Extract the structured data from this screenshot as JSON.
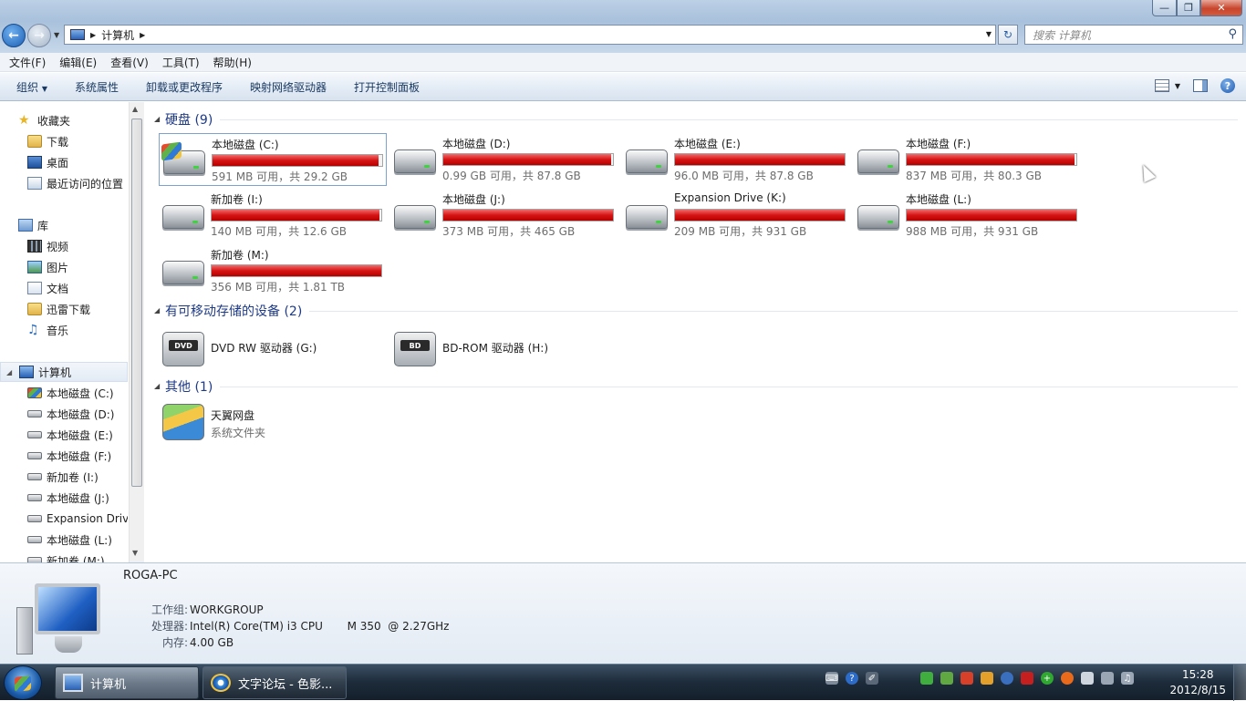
{
  "window": {
    "address": {
      "location": "计算机"
    },
    "search": {
      "placeholder": "搜索 计算机"
    }
  },
  "menu": [
    "文件(F)",
    "编辑(E)",
    "查看(V)",
    "工具(T)",
    "帮助(H)"
  ],
  "toolbar": {
    "organize": "组织",
    "items": [
      "系统属性",
      "卸载或更改程序",
      "映射网络驱动器",
      "打开控制面板"
    ]
  },
  "nav": {
    "favorites": {
      "label": "收藏夹",
      "items": [
        "下载",
        "桌面",
        "最近访问的位置"
      ]
    },
    "libraries": {
      "label": "库",
      "items": [
        "视频",
        "图片",
        "文档",
        "迅雷下载",
        "音乐"
      ]
    },
    "computer": {
      "label": "计算机",
      "items": [
        "本地磁盘 (C:)",
        "本地磁盘 (D:)",
        "本地磁盘 (E:)",
        "本地磁盘 (F:)",
        "新加卷 (I:)",
        "本地磁盘 (J:)",
        "Expansion Drive (K:)",
        "本地磁盘 (L:)",
        "新加卷 (M:)"
      ]
    }
  },
  "groups": {
    "hdd": {
      "title": "硬盘 (9)",
      "drives": [
        {
          "name": "本地磁盘 (C:)",
          "free": "591 MB 可用，共 29.2 GB",
          "used_fraction": 0.98
        },
        {
          "name": "本地磁盘 (D:)",
          "free": "0.99 GB 可用，共 87.8 GB",
          "used_fraction": 0.99
        },
        {
          "name": "本地磁盘 (E:)",
          "free": "96.0 MB 可用，共 87.8 GB",
          "used_fraction": 0.999
        },
        {
          "name": "本地磁盘 (F:)",
          "free": "837 MB 可用，共 80.3 GB",
          "used_fraction": 0.99
        },
        {
          "name": "新加卷 (I:)",
          "free": "140 MB 可用，共 12.6 GB",
          "used_fraction": 0.99
        },
        {
          "name": "本地磁盘 (J:)",
          "free": "373 MB 可用，共 465 GB",
          "used_fraction": 0.999
        },
        {
          "name": "Expansion Drive (K:)",
          "free": "209 MB 可用，共 931 GB",
          "used_fraction": 0.999
        },
        {
          "name": "本地磁盘 (L:)",
          "free": "988 MB 可用，共 931 GB",
          "used_fraction": 0.999
        },
        {
          "name": "新加卷 (M:)",
          "free": "356 MB 可用，共 1.81 TB",
          "used_fraction": 0.999
        }
      ]
    },
    "removable": {
      "title": "有可移动存储的设备 (2)",
      "devices": [
        {
          "name": "DVD RW 驱动器 (G:)",
          "badge": "DVD"
        },
        {
          "name": "BD-ROM 驱动器 (H:)",
          "badge": "BD"
        }
      ]
    },
    "other": {
      "title": "其他 (1)",
      "items": [
        {
          "name": "天翼网盘",
          "sub": "系统文件夹"
        }
      ]
    }
  },
  "details": {
    "pc_name": "ROGA-PC",
    "rows": [
      {
        "label": "工作组:",
        "value": "WORKGROUP"
      },
      {
        "label": "处理器:",
        "value": "Intel(R) Core(TM) i3 CPU       M 350  @ 2.27GHz"
      },
      {
        "label": "内存:",
        "value": "4.00 GB"
      }
    ]
  },
  "taskbar": {
    "tasks": [
      "计算机",
      "文字论坛 - 色影..."
    ],
    "clock": {
      "time": "15:28",
      "date": "2012/8/15"
    }
  },
  "colors": {
    "bar_fill": "#d71414",
    "group_title": "#1e3a87",
    "accent": "#1c5fb3"
  }
}
